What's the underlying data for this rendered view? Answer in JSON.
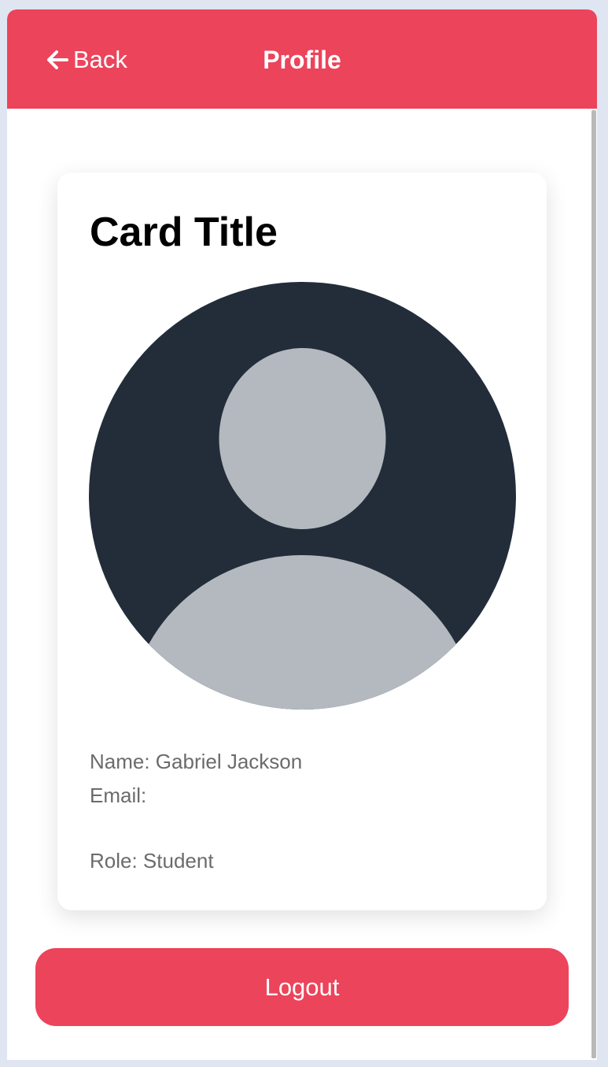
{
  "header": {
    "back_label": "Back",
    "title": "Profile",
    "back_icon": "arrow-left-icon"
  },
  "card": {
    "title": "Card Title",
    "avatar_icon": "user-avatar-icon",
    "name": "Name: Gabriel Jackson",
    "email": "Email:",
    "role": "Role: Student"
  },
  "actions": {
    "logout_label": "Logout"
  },
  "colors": {
    "accent": "#ec445b",
    "background": "#dfe6f2",
    "avatar_background": "#222d39",
    "avatar_figure": "#b3b9bf",
    "info_text": "#6b6b6b"
  }
}
